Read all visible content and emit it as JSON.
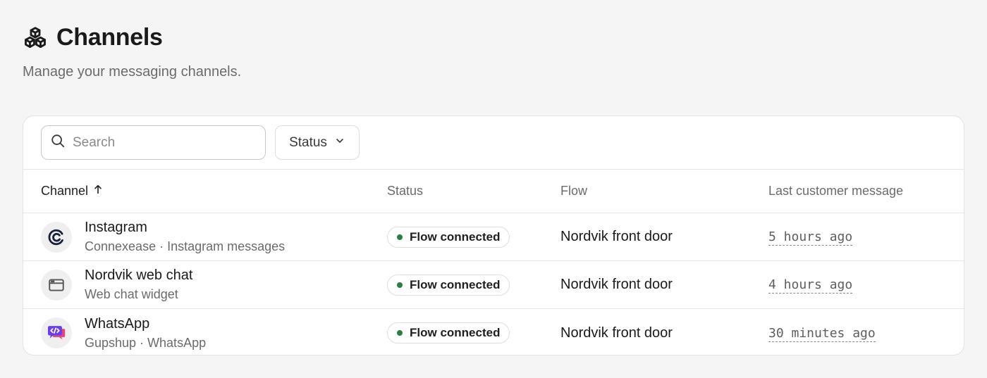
{
  "header": {
    "title": "Channels",
    "subtitle": "Manage your messaging channels."
  },
  "toolbar": {
    "search_placeholder": "Search",
    "search_value": "",
    "status_filter_label": "Status"
  },
  "table": {
    "columns": {
      "channel": "Channel",
      "status": "Status",
      "flow": "Flow",
      "last_message": "Last customer message"
    },
    "sort": {
      "column": "channel",
      "direction": "ascending"
    },
    "rows": [
      {
        "name": "Instagram",
        "subtitle": "Connexease · Instagram messages",
        "icon": "connexease-logo-icon",
        "status": "Flow connected",
        "flow": "Nordvik front door",
        "last_message": "5 hours ago"
      },
      {
        "name": "Nordvik web chat",
        "subtitle": "Web chat widget",
        "icon": "browser-window-icon",
        "status": "Flow connected",
        "flow": "Nordvik front door",
        "last_message": "4 hours ago"
      },
      {
        "name": "WhatsApp",
        "subtitle": "Gupshup · WhatsApp",
        "icon": "gupshup-logo-icon",
        "status": "Flow connected",
        "flow": "Nordvik front door",
        "last_message": "30 minutes ago"
      }
    ]
  },
  "colors": {
    "status_dot": "#2e7d46",
    "gupshup_purple": "#6c3df0",
    "gupshup_pink": "#e8457a"
  }
}
